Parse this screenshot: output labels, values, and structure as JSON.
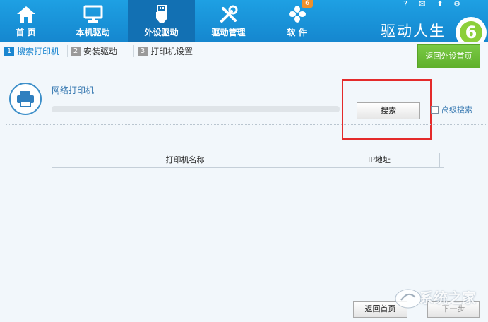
{
  "nav": {
    "items": [
      {
        "label": "首 页",
        "icon": "home-icon"
      },
      {
        "label": "本机驱动",
        "icon": "monitor-icon"
      },
      {
        "label": "外设驱动",
        "icon": "usb-icon"
      },
      {
        "label": "驱动管理",
        "icon": "tools-icon"
      },
      {
        "label": "软 件",
        "icon": "apps-icon"
      }
    ],
    "software_badge": "6",
    "brand": "驱动人生",
    "logo_number": "6"
  },
  "window_controls": [
    "?",
    "✉",
    "⬆",
    "⚙"
  ],
  "steps": [
    {
      "number": "1",
      "label": "搜索打印机"
    },
    {
      "number": "2",
      "label": "安装驱动"
    },
    {
      "number": "3",
      "label": "打印机设置"
    }
  ],
  "back_to_peripheral_home": "返回外设首页",
  "printer_section": {
    "title": "网络打印机",
    "search_button": "搜索",
    "advanced_search": "高级搜索"
  },
  "table": {
    "columns": [
      "打印机名称",
      "IP地址"
    ]
  },
  "bottom": {
    "back_label": "返回",
    "back_label_tail": "首页",
    "next_label": "下一步"
  },
  "watermark": "系统之家",
  "colors": {
    "top_bar": "#1a94dc",
    "accent_blue": "#1a86d0",
    "highlight_red": "#e42a2a",
    "green_button": "#6cbc37",
    "badge_orange": "#f0902b"
  }
}
